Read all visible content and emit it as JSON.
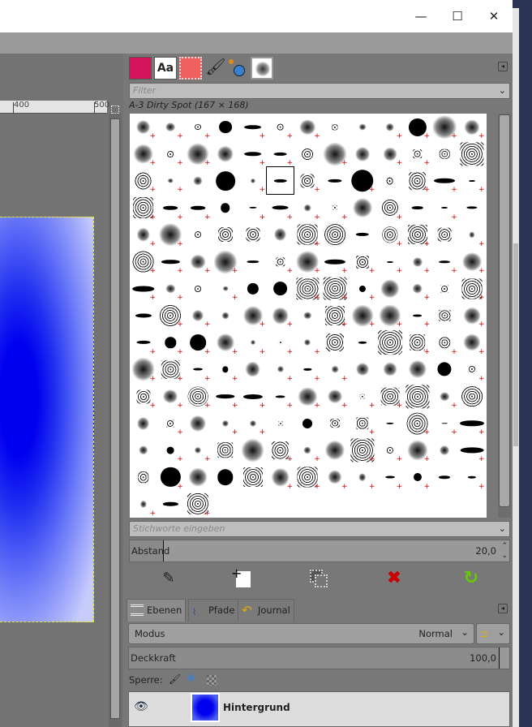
{
  "window": {
    "minimize": "—",
    "maximize": "☐",
    "close": "✕"
  },
  "ruler": {
    "ticks": [
      "400",
      "500"
    ]
  },
  "brushes": {
    "tabs": [
      "foreground-color",
      "fonts",
      "patterns",
      "paint-dynamics",
      "tool-presets",
      "brushes"
    ],
    "filter_placeholder": "Filter",
    "selected_brush": "A-3 Dirty Spot (167 × 168)",
    "tags_placeholder": "Stichworte eingeben",
    "spacing_label": "Abstand",
    "spacing_value": "20,0",
    "spacing_fraction": 0.2,
    "actions": [
      "edit-brush",
      "new-brush",
      "duplicate-brush",
      "delete-brush",
      "refresh-brushes"
    ],
    "colors": {
      "foreground": "#d4145a",
      "delete": "#cc0000",
      "refresh": "#66cc00"
    }
  },
  "layers_dock": {
    "tabs": [
      {
        "label": "Ebenen"
      },
      {
        "label": "Pfade"
      },
      {
        "label": "Journal"
      }
    ],
    "mode_label": "Modus",
    "mode_value": "Normal",
    "opacity_label": "Deckkraft",
    "opacity_value": "100,0",
    "lock_label": "Sperre:",
    "layers": [
      {
        "name": "Hintergrund",
        "visible": true
      }
    ]
  }
}
